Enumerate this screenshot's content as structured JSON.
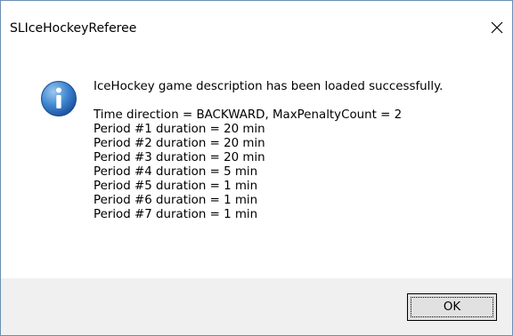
{
  "window": {
    "title": "SLIceHockeyReferee",
    "close_glyph": "✕"
  },
  "dialog": {
    "icon": "info-icon",
    "headline": "IceHockey game description has been loaded successfully.",
    "details": [
      "Time direction = BACKWARD, MaxPenaltyCount = 2",
      "Period #1 duration = 20 min",
      "Period #2 duration = 20 min",
      "Period #3 duration = 20 min",
      "Period #4 duration = 5 min",
      "Period #5 duration = 1 min",
      "Period #6 duration = 1 min",
      "Period #7 duration = 1 min"
    ]
  },
  "buttons": {
    "ok_label": "OK"
  },
  "colors": {
    "info_blue_light": "#5b9bd5",
    "info_blue_dark": "#1f5aa6",
    "footer_bg": "#f0f0f0",
    "button_bg": "#e1e1e1"
  }
}
